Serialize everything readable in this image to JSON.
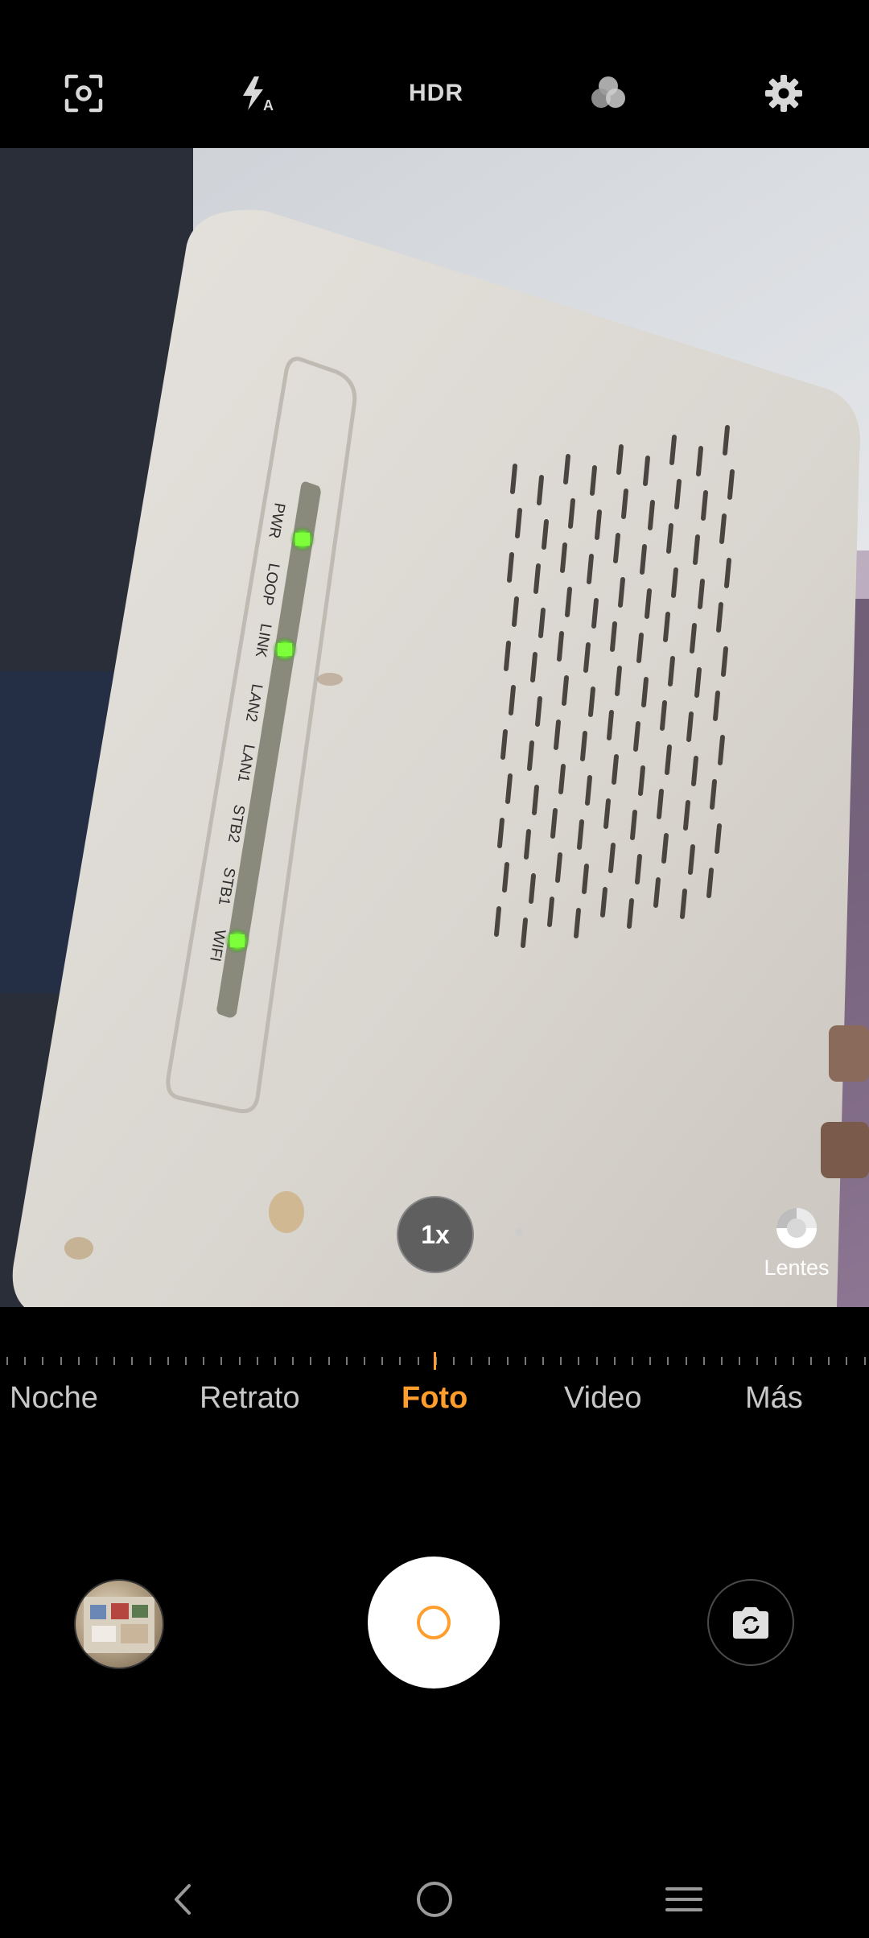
{
  "top_bar": {
    "icons": [
      "focus-frame-icon",
      "flash-auto-icon",
      "filter-icon",
      "gear-icon"
    ],
    "hdr_label": "HDR"
  },
  "viewfinder": {
    "zoom_label": "1x",
    "lens_label": "Lentes",
    "subject_labels": [
      "PWR",
      "LOOP",
      "LINK",
      "LAN2",
      "LAN1",
      "STB2",
      "STB1",
      "WIFI"
    ]
  },
  "modes": {
    "items": [
      "Noche",
      "Retrato",
      "Foto",
      "Video",
      "Más"
    ],
    "active": "Foto"
  },
  "colors": {
    "accent": "#ff9e2c",
    "led_green": "#7dff3a",
    "router_body": "#dcd8d2"
  },
  "nav_bar": {
    "icons": [
      "back-icon",
      "home-icon",
      "menu-icon"
    ]
  }
}
